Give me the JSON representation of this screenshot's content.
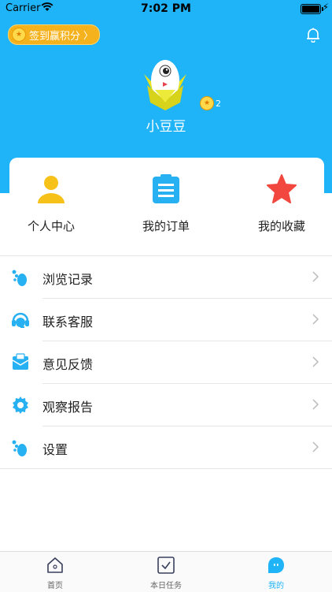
{
  "status_bar": {
    "carrier": "Carrier",
    "time": "7:02 PM"
  },
  "header": {
    "signin_label": "签到赢积分",
    "username": "小豆豆",
    "points": "2",
    "background_color": "#1fb3f7"
  },
  "quick_actions": [
    {
      "label": "个人中心",
      "icon": "person-icon"
    },
    {
      "label": "我的订单",
      "icon": "order-clipboard-icon"
    },
    {
      "label": "我的收藏",
      "icon": "star-icon"
    }
  ],
  "menu": [
    {
      "label": "浏览记录",
      "icon": "footprint-icon"
    },
    {
      "label": "联系客服",
      "icon": "headset-icon"
    },
    {
      "label": "意见反馈",
      "icon": "feedback-icon"
    },
    {
      "label": "观察报告",
      "icon": "gear-icon"
    },
    {
      "label": "设置",
      "icon": "footprint-icon"
    }
  ],
  "tabbar": [
    {
      "label": "首页",
      "icon": "home-icon"
    },
    {
      "label": "本日任务",
      "icon": "task-check-icon"
    },
    {
      "label": "我的",
      "icon": "profile-bubble-icon",
      "active": true
    }
  ]
}
